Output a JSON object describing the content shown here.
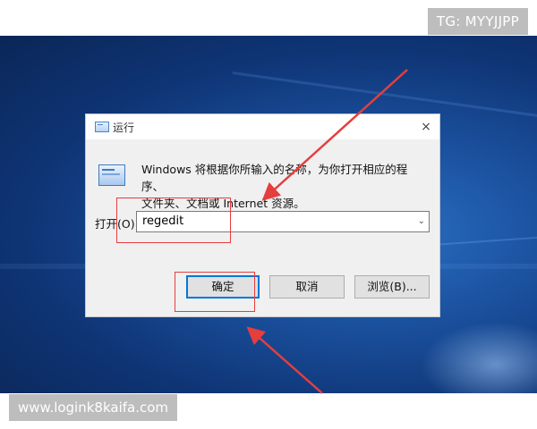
{
  "watermarks": {
    "top": "TG: MYYJJPP",
    "bottom": "www.logink8kaifa.com"
  },
  "dialog": {
    "title": "运行",
    "close": "×",
    "description_line1": "Windows 将根据你所输入的名称，为你打开相应的程序、",
    "description_line2": "文件夹、文档或 Internet 资源。",
    "open_label": "打开(O):",
    "open_value": "regedit",
    "buttons": {
      "ok": "确定",
      "cancel": "取消",
      "browse": "浏览(B)..."
    }
  },
  "annotation_color": "#e53e3e"
}
